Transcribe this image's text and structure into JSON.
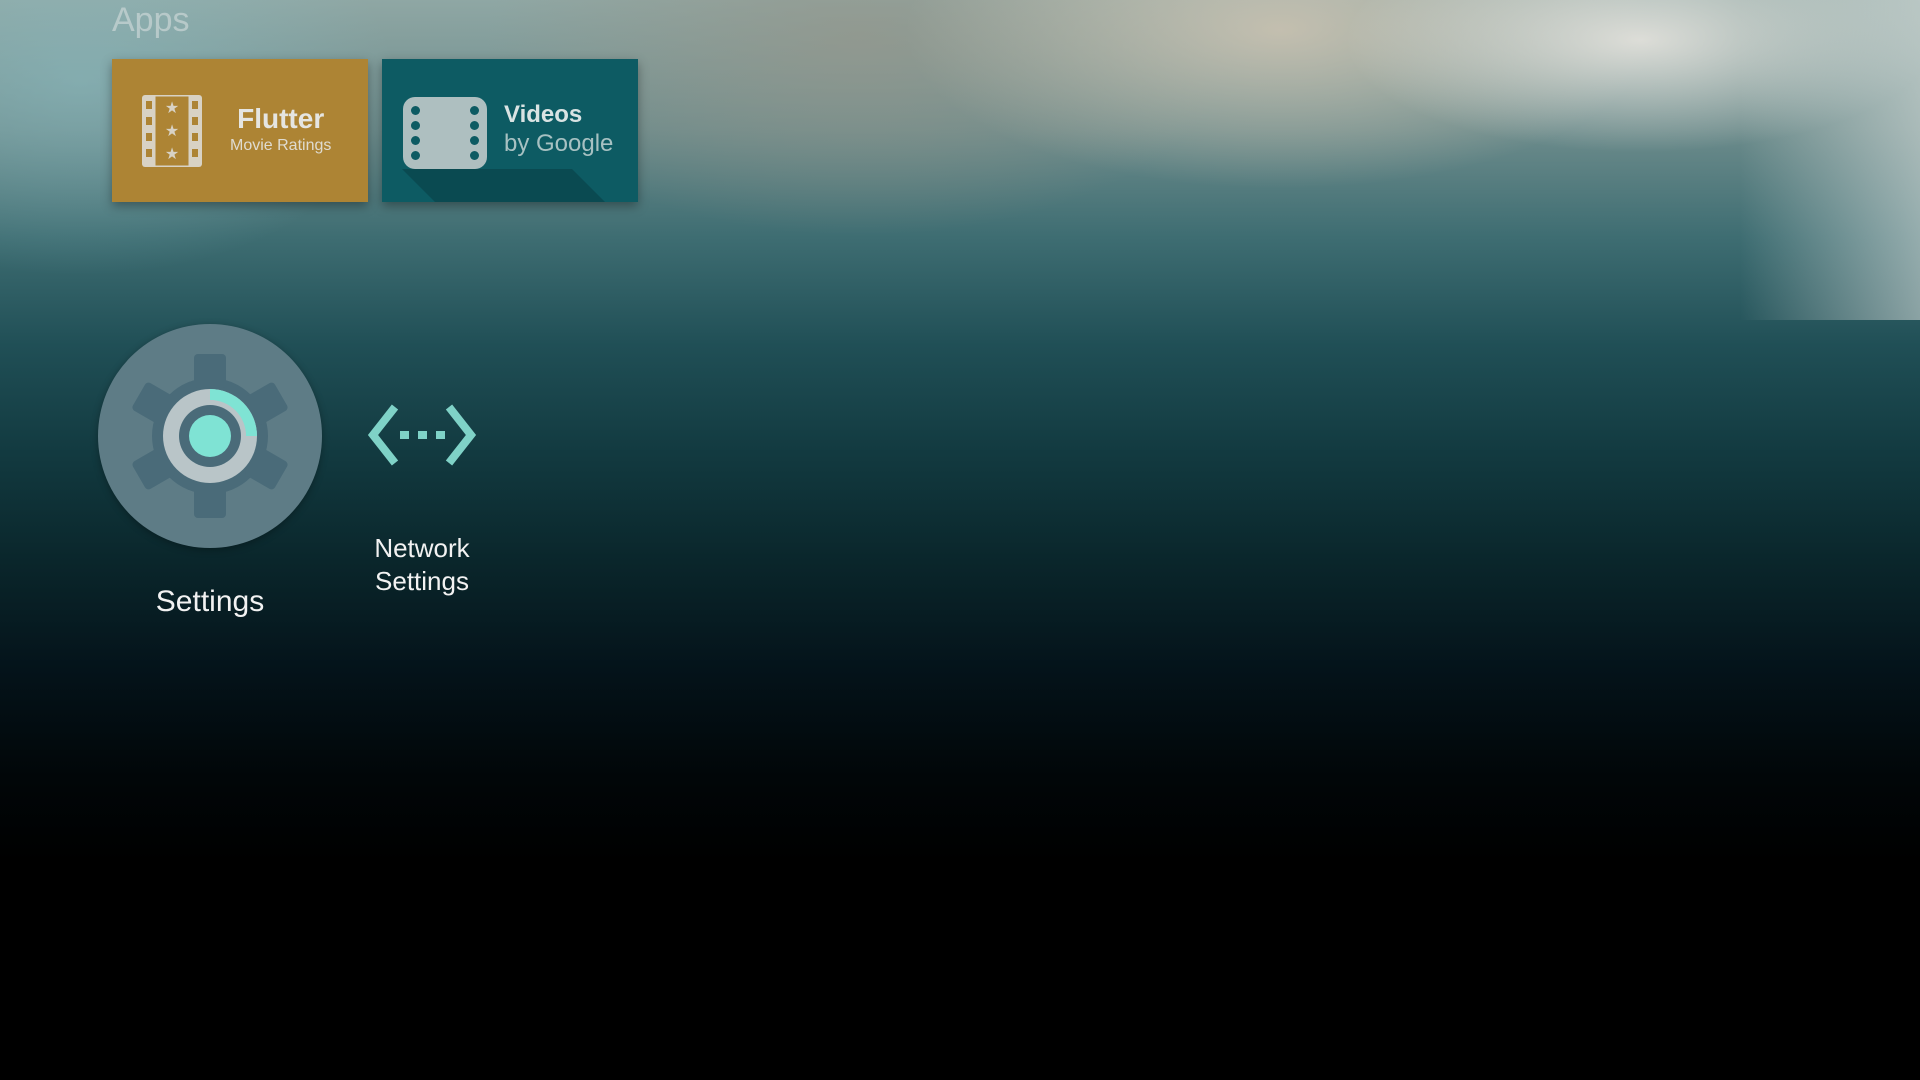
{
  "section": {
    "title": "Apps"
  },
  "tiles": [
    {
      "name": "Flutter",
      "subtitle": "Movie Ratings",
      "color": "#ad8434",
      "icon": "film-stars-icon"
    },
    {
      "name": "Videos",
      "subtitle": "by Google",
      "color": "#0d5b63",
      "icon": "film-strip-icon"
    }
  ],
  "settings_items": [
    {
      "label": "Settings",
      "icon": "gear-icon"
    },
    {
      "label": "Network Settings",
      "icon": "network-arrows-icon"
    }
  ],
  "colors": {
    "accent": "#7fe3d4",
    "gear": "#4a6b79",
    "circle": "#5e7c86"
  }
}
